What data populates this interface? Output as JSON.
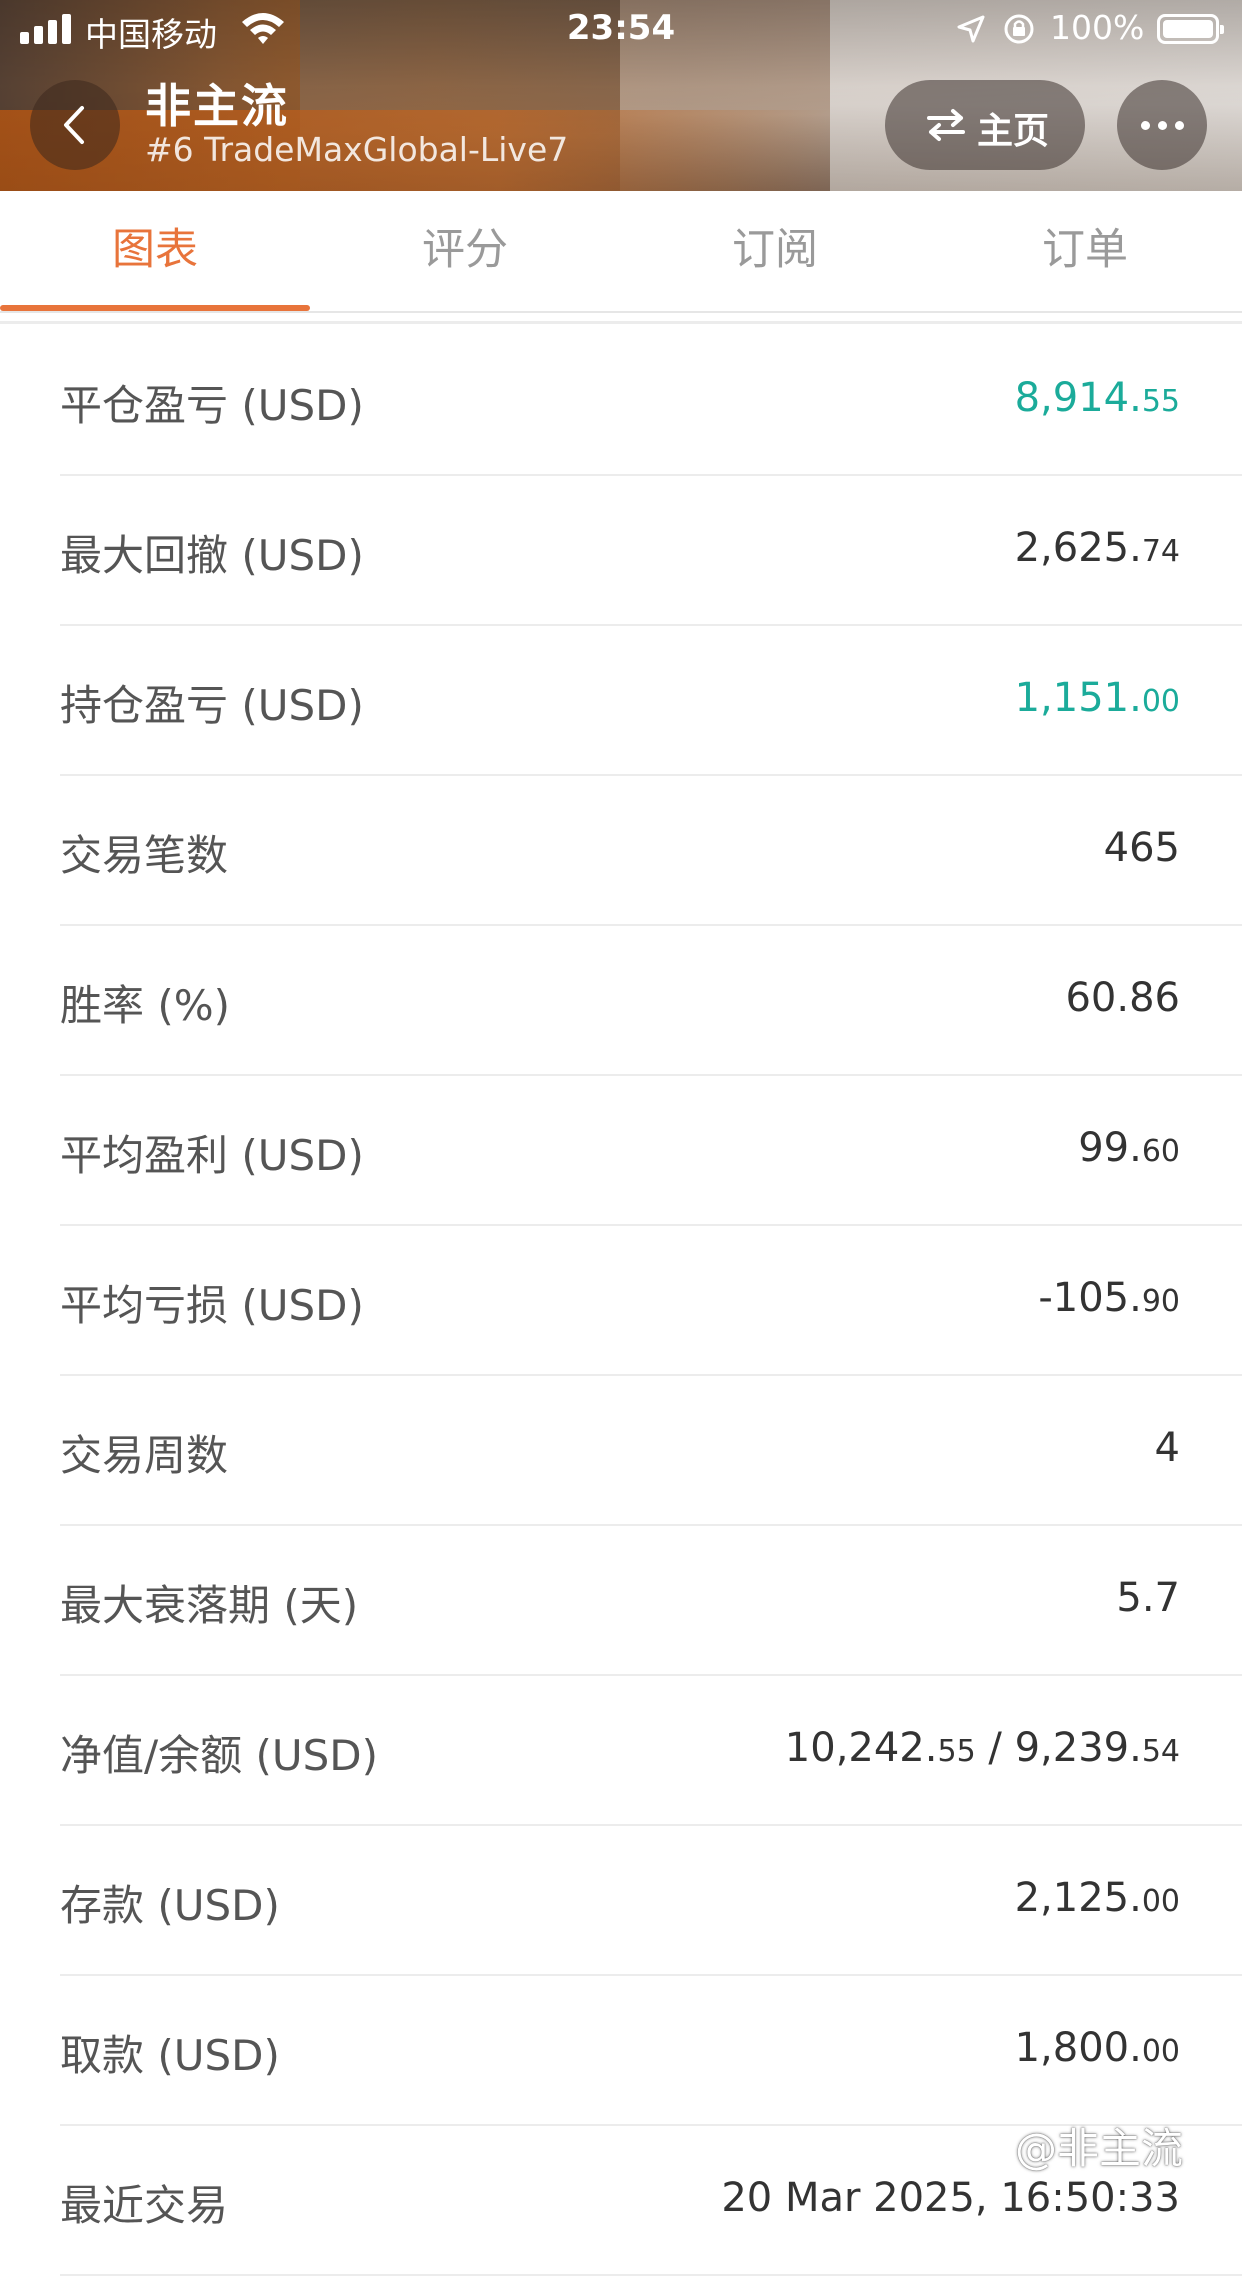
{
  "status_bar": {
    "carrier": "中国移动",
    "time": "23:54",
    "battery": "100%"
  },
  "header": {
    "title": "非主流",
    "subtitle": "#6 TradeMaxGlobal-Live7",
    "home_label": "主页"
  },
  "tabs": [
    {
      "label": "图表",
      "active": true
    },
    {
      "label": "评分",
      "active": false
    },
    {
      "label": "订阅",
      "active": false
    },
    {
      "label": "订单",
      "active": false
    }
  ],
  "stats": [
    {
      "label": "平仓盈亏 (USD)",
      "int": "8,914.",
      "frac": "55",
      "green": true
    },
    {
      "label": "最大回撤 (USD)",
      "int": "2,625.",
      "frac": "74",
      "green": false
    },
    {
      "label": "持仓盈亏 (USD)",
      "int": "1,151.",
      "frac": "00",
      "green": true
    },
    {
      "label": "交易笔数",
      "int": "465",
      "frac": "",
      "green": false
    },
    {
      "label": "胜率 (%)",
      "int": "60.86",
      "frac": "",
      "green": false
    },
    {
      "label": "平均盈利 (USD)",
      "int": "99.",
      "frac": "60",
      "green": false
    },
    {
      "label": "平均亏损 (USD)",
      "int": "-105.",
      "frac": "90",
      "green": false
    },
    {
      "label": "交易周数",
      "int": "4",
      "frac": "",
      "green": false
    },
    {
      "label": "最大衰落期 (天)",
      "int": "5.7",
      "frac": "",
      "green": false
    },
    {
      "label": "净值/余额 (USD)",
      "int": "10,242.",
      "frac": "55",
      "int2": " / 9,239.",
      "frac2": "54",
      "green": false
    },
    {
      "label": "存款 (USD)",
      "int": "2,125.",
      "frac": "00",
      "green": false
    },
    {
      "label": "取款 (USD)",
      "int": "1,800.",
      "frac": "00",
      "green": false
    },
    {
      "label": "最近交易",
      "int": "20 Mar 2025, 16:50:33",
      "frac": "",
      "green": false
    }
  ],
  "watermark": "@非主流",
  "colors": {
    "accent": "#e8743b",
    "positive": "#1bab9a"
  }
}
